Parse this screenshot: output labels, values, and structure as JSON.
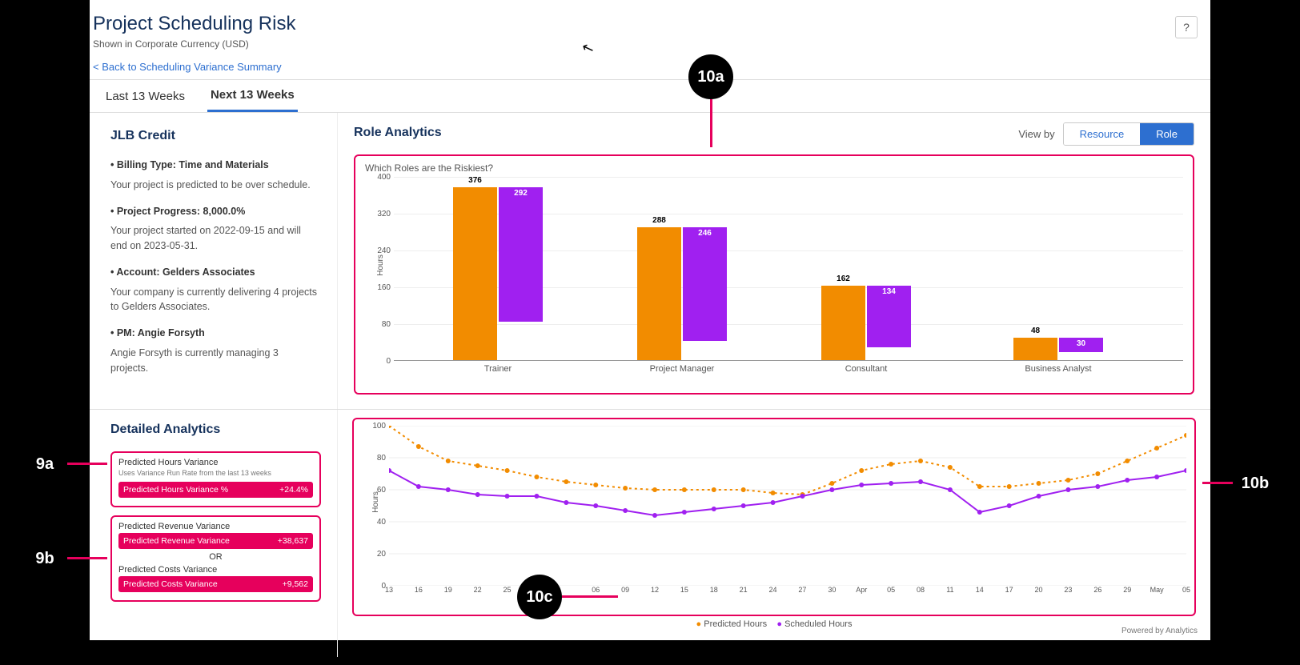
{
  "header": {
    "title": "Project Scheduling Risk",
    "subtitle": "Shown in Corporate Currency (USD)",
    "back_link": "< Back to Scheduling Variance Summary",
    "help_label": "?"
  },
  "tabs": {
    "last": "Last 13 Weeks",
    "next": "Next 13 Weeks"
  },
  "project": {
    "name": "JLB Credit",
    "billing_label": "• Billing Type: Time and Materials",
    "billing_sub": "Your project is predicted to be over schedule.",
    "progress_label": "• Project Progress: 8,000.0%",
    "progress_sub": "Your project started on 2022-09-15 and will end on 2023-05-31.",
    "account_label": "• Account: Gelders Associates",
    "account_sub": "Your company is currently delivering 4 projects to Gelders Associates.",
    "pm_label": "• PM: Angie Forsyth",
    "pm_sub": "Angie Forsyth is currently managing 3 projects."
  },
  "role_analytics": {
    "section": "Role Analytics",
    "viewby_label": "View by",
    "toggle_resource": "Resource",
    "toggle_role": "Role"
  },
  "chart_data": [
    {
      "id": "roles_bar",
      "type": "bar",
      "title": "Which Roles are the Riskiest?",
      "ylabel": "Hours",
      "ylim": [
        0,
        400
      ],
      "yticks": [
        0,
        80,
        160,
        240,
        320,
        400
      ],
      "categories": [
        "Trainer",
        "Project Manager",
        "Consultant",
        "Business Analyst"
      ],
      "series": [
        {
          "name": "Predicted Hours",
          "color": "#f28c00",
          "values": [
            376,
            288,
            162,
            48
          ]
        },
        {
          "name": "Scheduled Hours",
          "color": "#a020f0",
          "values": [
            292,
            246,
            134,
            30
          ]
        }
      ]
    },
    {
      "id": "hours_line",
      "type": "line",
      "ylabel": "Hours",
      "ylim": [
        0,
        100
      ],
      "yticks": [
        0,
        20,
        40,
        60,
        80,
        100
      ],
      "xticks": [
        "13",
        "16",
        "19",
        "22",
        "25",
        "",
        "",
        "06",
        "09",
        "12",
        "15",
        "18",
        "21",
        "24",
        "27",
        "30",
        "Apr",
        "05",
        "08",
        "11",
        "14",
        "17",
        "20",
        "23",
        "26",
        "29",
        "May",
        "05"
      ],
      "series": [
        {
          "name": "Predicted Hours",
          "color": "#f28c00",
          "style": "dotted",
          "values": [
            100,
            87,
            78,
            75,
            72,
            68,
            65,
            63,
            61,
            60,
            60,
            60,
            60,
            58,
            57,
            64,
            72,
            76,
            78,
            74,
            62,
            62,
            64,
            66,
            70,
            78,
            86,
            94
          ]
        },
        {
          "name": "Scheduled Hours",
          "color": "#a020f0",
          "style": "solid",
          "values": [
            72,
            62,
            60,
            57,
            56,
            56,
            52,
            50,
            47,
            44,
            46,
            48,
            50,
            52,
            56,
            60,
            63,
            64,
            65,
            60,
            46,
            50,
            56,
            60,
            62,
            66,
            68,
            72
          ]
        }
      ],
      "legend": {
        "predicted": "Predicted Hours",
        "scheduled": "Scheduled Hours"
      }
    }
  ],
  "detailed": {
    "section": "Detailed Analytics",
    "card_a": {
      "title": "Predicted Hours Variance",
      "sub": "Uses Variance Run Rate from the last 13 weeks",
      "row_label": "Predicted Hours Variance %",
      "row_value": "+24.4%"
    },
    "card_b": {
      "title1": "Predicted Revenue Variance",
      "row1_label": "Predicted Revenue Variance",
      "row1_value": "+38,637",
      "or": "OR",
      "title2": "Predicted Costs Variance",
      "row2_label": "Predicted Costs Variance",
      "row2_value": "+9,562"
    }
  },
  "footer": "Powered by Analytics",
  "annotations": {
    "a9a": "9a",
    "a9b": "9b",
    "a10a": "10a",
    "a10b": "10b",
    "a10c": "10c"
  }
}
